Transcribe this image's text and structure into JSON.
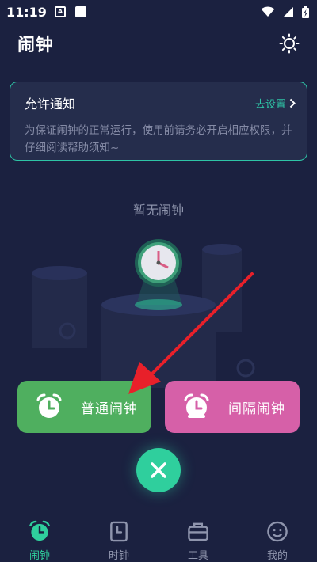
{
  "status_bar": {
    "time": "11:19",
    "a_icon_letter": "A"
  },
  "header": {
    "title": "闹钟",
    "settings_icon": "sun-settings-icon"
  },
  "notice": {
    "title": "允许通知",
    "link_label": "去设置",
    "body": "为保证闹钟的正常运行，使用前请务必开启相应权限，并仔细阅读帮助须知~"
  },
  "empty": {
    "text": "暂无闹钟"
  },
  "actions": {
    "normal_label": "普通闹钟",
    "interval_label": "间隔闹钟"
  },
  "nav": {
    "items": [
      {
        "label": "闹钟",
        "icon": "alarm-icon",
        "active": true
      },
      {
        "label": "时钟",
        "icon": "clock-icon",
        "active": false
      },
      {
        "label": "工具",
        "icon": "toolbox-icon",
        "active": false
      },
      {
        "label": "我的",
        "icon": "profile-icon",
        "active": false
      }
    ]
  },
  "colors": {
    "background": "#1b2140",
    "accent": "#2fcf9d",
    "notice_border": "#2ec4a6",
    "normal_button": "#4faf5f",
    "interval_button": "#d660a8",
    "annotation_arrow": "#e8202a"
  }
}
